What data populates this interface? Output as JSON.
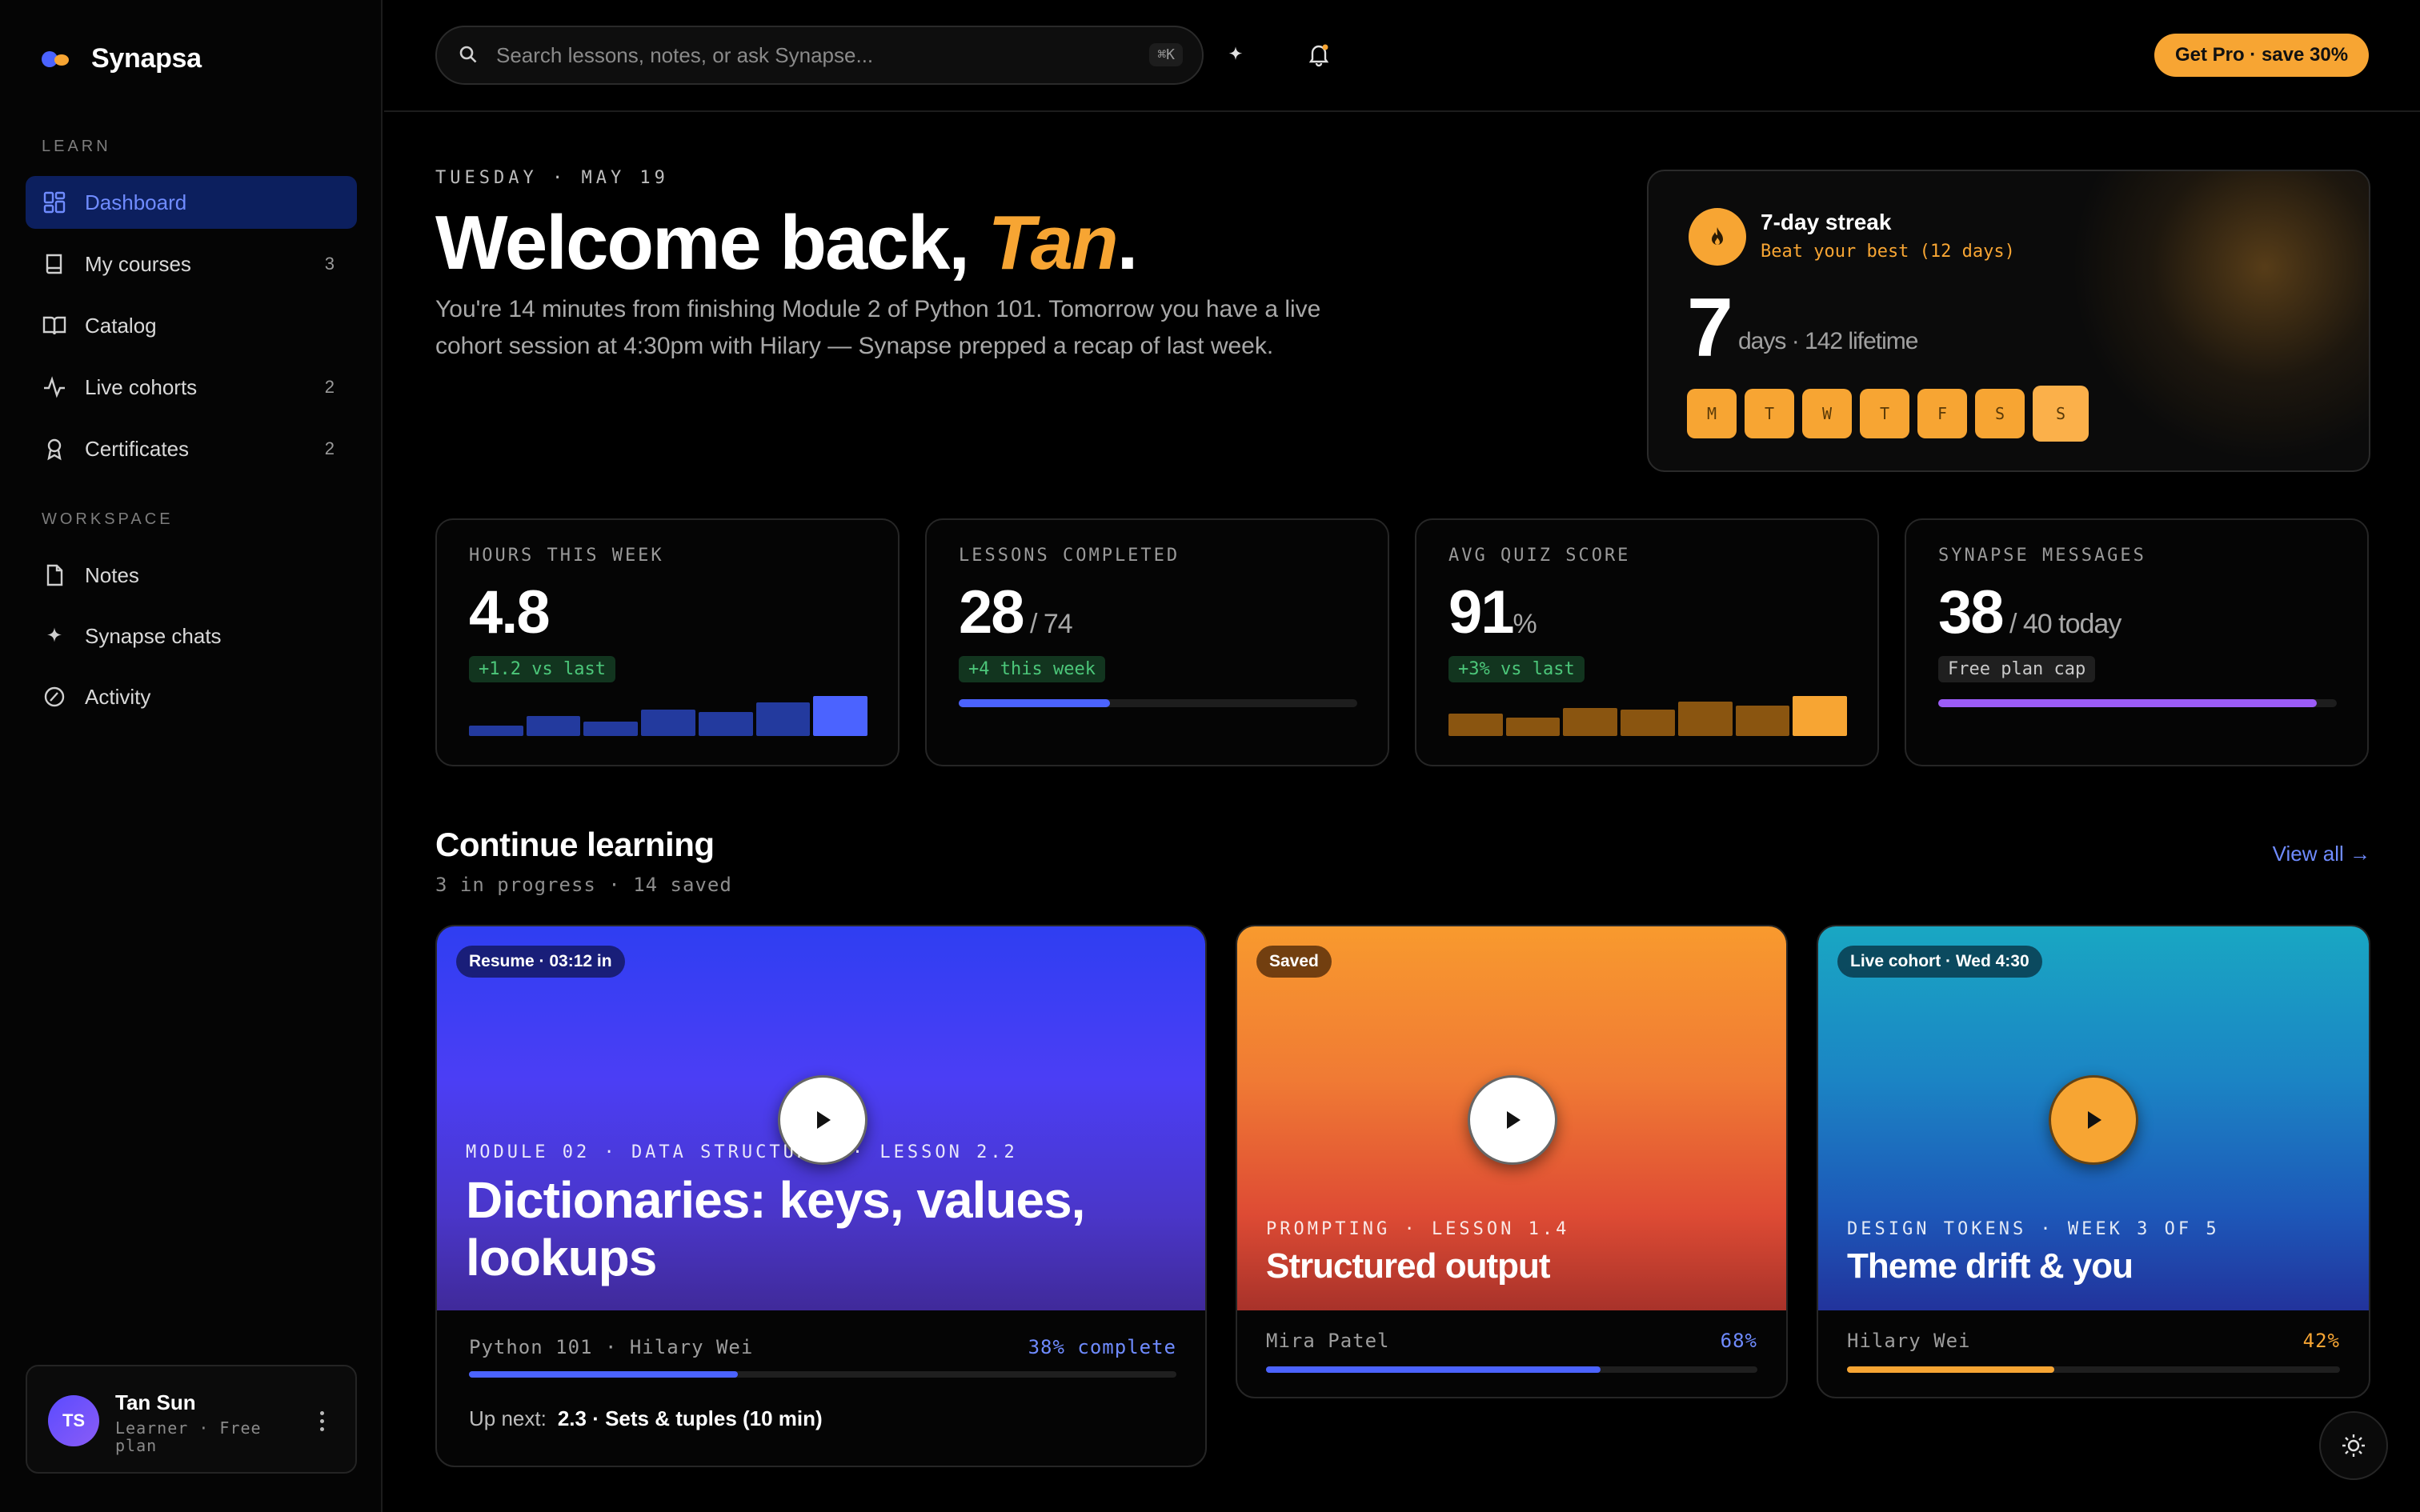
{
  "brand": {
    "name": "Synapsa"
  },
  "sidebar": {
    "learn_label": "LEARN",
    "workspace_label": "WORKSPACE",
    "learn_items": [
      {
        "label": "Dashboard",
        "icon": "grid-icon",
        "active": true
      },
      {
        "label": "My courses",
        "icon": "book-icon",
        "count": "3"
      },
      {
        "label": "Catalog",
        "icon": "open-book-icon"
      },
      {
        "label": "Live cohorts",
        "icon": "pulse-icon",
        "count": "2"
      },
      {
        "label": "Certificates",
        "icon": "award-icon",
        "count": "2"
      }
    ],
    "workspace_items": [
      {
        "label": "Notes",
        "icon": "file-icon"
      },
      {
        "label": "Synapse chats",
        "icon": "sparkle-icon"
      },
      {
        "label": "Activity",
        "icon": "gauge-icon"
      }
    ]
  },
  "user": {
    "initials": "TS",
    "name": "Tan Sun",
    "plan": "Learner · Free plan"
  },
  "topbar": {
    "search_placeholder": "Search lessons, notes, or ask Synapse...",
    "shortcut": "⌘K",
    "pro_label": "Get Pro · save 30%"
  },
  "hero": {
    "date": "TUESDAY · MAY 19",
    "welcome_prefix": "Welcome back, ",
    "name": "Tan",
    "welcome_suffix": ".",
    "intro": "You're 14 minutes from finishing Module 2 of Python 101. Tomorrow you have a live cohort session at 4:30pm with Hilary — Synapse prepped a recap of last week."
  },
  "streak": {
    "title": "7-day streak",
    "subtitle": "Beat your best (12 days)",
    "value": "7",
    "meta": "days · 142 lifetime",
    "days": [
      "M",
      "T",
      "W",
      "T",
      "F",
      "S",
      "S"
    ]
  },
  "stats": {
    "hours": {
      "label": "HOURS THIS WEEK",
      "value": "4.8",
      "chip": "+1.2 vs last",
      "bars": [
        0.26,
        0.5,
        0.36,
        0.66,
        0.6,
        0.84,
        1.0
      ]
    },
    "lessons": {
      "label": "LESSONS COMPLETED",
      "value": "28",
      "unit": " / 74",
      "chip": "+4 this week",
      "progress": 0.38
    },
    "quiz": {
      "label": "AVG QUIZ SCORE",
      "value": "91",
      "unit": "%",
      "chip": "+3% vs last",
      "bars": [
        0.56,
        0.46,
        0.7,
        0.66,
        0.86,
        0.76,
        1.0
      ]
    },
    "messages": {
      "label": "SYNAPSE MESSAGES",
      "value": "38",
      "unit": " / 40 today",
      "chip": "Free plan cap",
      "progress": 0.95
    }
  },
  "continue": {
    "title": "Continue learning",
    "subtitle": "3 in progress · 14 saved",
    "view_all": "View all →",
    "courses": [
      {
        "badge": "Resume · 03:12 in",
        "eyebrow": "MODULE 02 · DATA STRUCTURES · LESSON 2.2",
        "title": "Dictionaries: keys, values, lookups",
        "author": "Python 101 · Hilary Wei",
        "percent_label": "38% complete",
        "progress": 0.38,
        "upnext_label": "Up next:",
        "upnext": "2.3 · Sets & tuples (10 min)"
      },
      {
        "badge": "Saved",
        "eyebrow": "PROMPTING · LESSON 1.4",
        "title": "Structured output",
        "author": "Mira Patel",
        "percent_label": "68%",
        "progress": 0.68
      },
      {
        "badge": "Live cohort · Wed 4:30",
        "eyebrow": "DESIGN TOKENS · WEEK 3 OF 5",
        "title": "Theme drift & you",
        "author": "Hilary Wei",
        "percent_label": "42%",
        "progress": 0.42
      }
    ]
  },
  "colors": {
    "accent_blue": "#4b63ff",
    "accent_orange": "#f7a533",
    "success": "#4cc77a",
    "purple": "#9b5cf6"
  }
}
